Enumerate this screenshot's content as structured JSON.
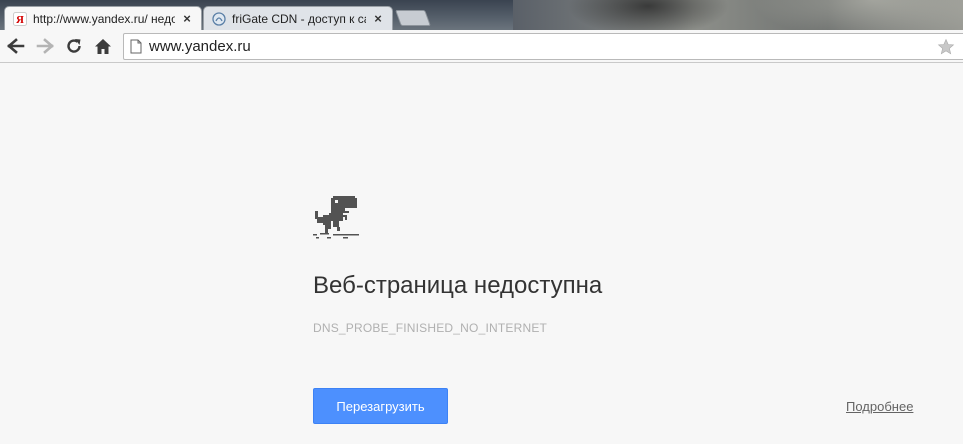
{
  "tabs": [
    {
      "title": "http://www.yandex.ru/ недо",
      "favicon": "yandex-favicon",
      "active": true
    },
    {
      "title": "friGate CDN - доступ к сайт",
      "favicon": "frigate-favicon",
      "active": false
    }
  ],
  "toolbar": {
    "back_icon": "back-arrow-icon",
    "forward_icon": "forward-arrow-icon",
    "reload_icon": "reload-icon",
    "home_icon": "home-icon",
    "url": "www.yandex.ru",
    "star_icon": "bookmark-star-icon"
  },
  "error_page": {
    "icon": "offline-dino-icon",
    "heading": "Веб-страница недоступна",
    "error_code": "DNS_PROBE_FINISHED_NO_INTERNET",
    "reload_button": "Перезагрузить",
    "details_link": "Подробнее",
    "accent_color": "#4d90fe"
  }
}
